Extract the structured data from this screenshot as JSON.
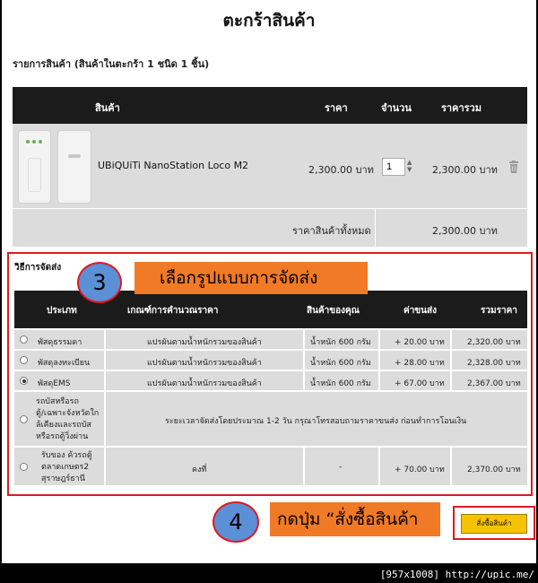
{
  "page_title": "ตะกร้าสินค้า",
  "cart_summary": "รายการสินค้า (สินค้าในตะกร้า 1 ชนิด 1 ชิ้น)",
  "cart": {
    "headers": {
      "product": "สินค้า",
      "price": "ราคา",
      "quantity": "จำนวน",
      "total": "ราคารวม"
    },
    "item": {
      "name": "UBiQUiTi NanoStation Loco M2",
      "price": "2,300.00 บาท",
      "quantity": "1",
      "total": "2,300.00 บาท"
    },
    "subtotal_label": "ราคาสินค้าทั้งหมด",
    "subtotal_value": "2,300.00 บาท"
  },
  "shipping": {
    "title": "วิธีการจัดส่ง",
    "headers": {
      "type": "ประเภท",
      "criteria": "เกณฑ์การคำนวณราคา",
      "your_items": "สินค้าของคุณ",
      "fee": "ค่าขนส่ง",
      "total": "รวมราคา"
    },
    "rows": [
      {
        "type": "พัสดุธรรมดา",
        "criteria": "แปรผันตามน้ำหนักรวมของสินค้า",
        "weight": "น้ำหนัก 600 กรัม",
        "fee": "+ 20.00 บาท",
        "total": "2,320.00 บาท",
        "selected": false
      },
      {
        "type": "พัสดุลงทะเบียน",
        "criteria": "แปรผันตามน้ำหนักรวมของสินค้า",
        "weight": "น้ำหนัก 600 กรัม",
        "fee": "+ 28.00 บาท",
        "total": "2,328.00 บาท",
        "selected": false
      },
      {
        "type": "พัสดุEMS",
        "criteria": "แปรผันตามน้ำหนักรวมของสินค้า",
        "weight": "น้ำหนัก 600 กรัม",
        "fee": "+ 67.00 บาท",
        "total": "2,367.00 บาท",
        "selected": true
      }
    ],
    "bus_row": {
      "type_lines": [
        "รถบัสหรือรถ",
        "ตู้/เฉพาะจังหวัดใก",
        "ล้เคียงและรถบัส",
        "หรือรถตู้วิ่งผ่าน"
      ],
      "note": "ระยะเวลาจัดส่งโดยประมาณ 1-2 วัน กรุณาโทรสอบถามราคาขนส่ง ก่อนทำการโอนเงิน"
    },
    "pickup_row": {
      "type_lines": [
        "รับของ ค้วรถตู้",
        "ตลาดเกษตร2",
        "สุราษฎร์ธานี"
      ],
      "criteria": "คงที่",
      "weight": "-",
      "fee": "+ 70.00 บาท",
      "total": "2,370.00 บาท"
    }
  },
  "annotations": {
    "step3_number": "3",
    "step3_text": "เลือกรูปแบบการจัดส่ง",
    "step4_number": "4",
    "step4_text": "กดปุ่ม “สั่งซื้อสินค้า"
  },
  "order_button_label": "สั่งซื้อสินค้า",
  "footer_tag": "[957x1008] http://upic.me/",
  "colors": {
    "header_bg": "#1b1b1b",
    "row_bg": "#dcdcdc",
    "highlight_red": "#e0191f",
    "banner_orange": "#f07a25",
    "badge_blue": "#5b8fd6",
    "button_yellow": "#f5c400"
  }
}
